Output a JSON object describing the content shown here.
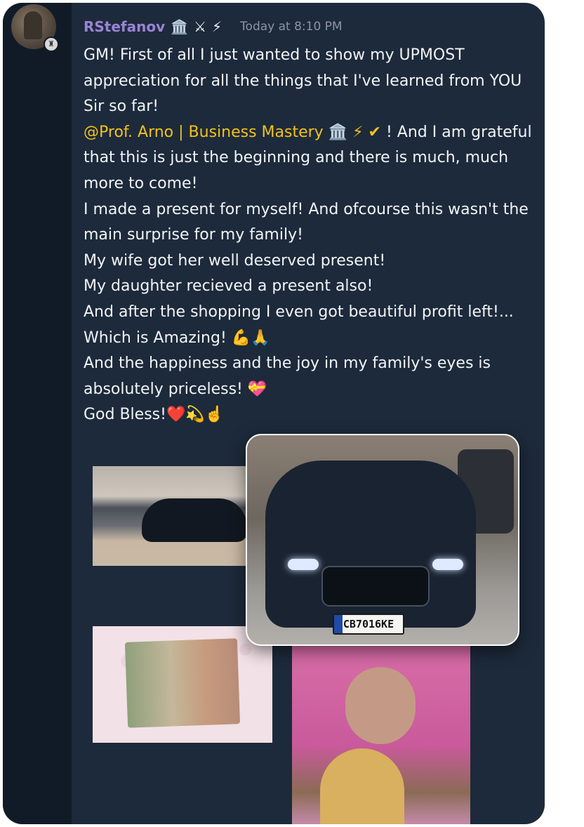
{
  "message": {
    "username": "RStefanov",
    "badges": [
      "🏛️",
      "⚔",
      "⚡"
    ],
    "timestamp": "Today at 8:10 PM",
    "lines": [
      "GM! First of all I just wanted to show my UPMOST appreciation for all the things that I've learned from YOU Sir so far!",
      "I made a present for myself! And ofcourse this wasn't the main surprise for my family!",
      "My wife got her well deserved present!",
      "My daughter recieved a present also!",
      "And after the shopping I even got beautiful profit left!...",
      "And the happiness and the joy in my family's eyes is absolutely priceless!"
    ],
    "mention": "@Prof. Arno | Business Mastery",
    "mention_badges": "🏛️ ⚡ ✔",
    "mention_tail": "! And I am grateful that this is just the beginning and there is much, much more to come!",
    "amazing_text": "Which is Amazing!",
    "amazing_emoji": "💪🙏",
    "priceless_emoji": "💝",
    "blessing_text": "God Bless!",
    "blessing_emoji": "❤️💫☝️"
  },
  "plate_text": "CB7016KE",
  "colors": {
    "username": "#9a84d6",
    "mention": "#f1c21b",
    "background": "#1d2a3b",
    "sidebar": "#111b27"
  },
  "icons": [
    "avatar",
    "server-badge-icon",
    "crossed-swords-icon",
    "lightning-icon",
    "verified-icon"
  ]
}
